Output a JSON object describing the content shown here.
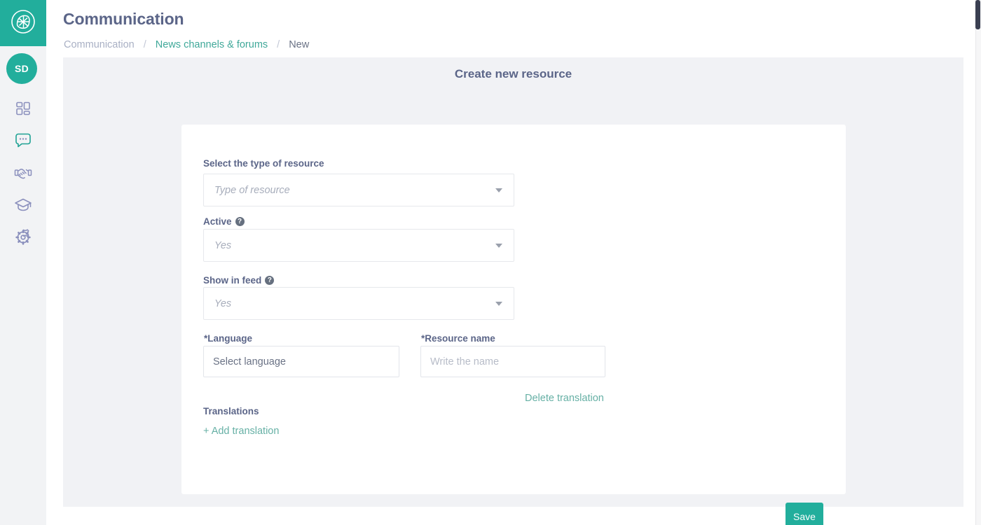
{
  "theme": {
    "accent": "#22ae9c",
    "link": "#66b0a5",
    "heading": "#5b6588",
    "muted": "#a9b0c4",
    "content_bg": "#f1f2f5",
    "sidebar_bg": "#f2f3f5"
  },
  "sidebar": {
    "logo": {
      "icon": "app-logo-icon"
    },
    "avatar": {
      "initials": "SD"
    },
    "items": [
      {
        "icon": "dashboard-grid-icon",
        "name": "sidebar-item-dashboard",
        "active": false
      },
      {
        "icon": "chat-bubble-icon",
        "name": "sidebar-item-communication",
        "active": true
      },
      {
        "icon": "handshake-icon",
        "name": "sidebar-item-collaboration",
        "active": false
      },
      {
        "icon": "graduation-cap-icon",
        "name": "sidebar-item-learning",
        "active": false
      },
      {
        "icon": "gear-icon",
        "name": "sidebar-item-settings",
        "active": false
      }
    ]
  },
  "header": {
    "title": "Communication",
    "breadcrumb": {
      "root": "Communication",
      "separator": "/",
      "section": "News channels & forums",
      "current": "New"
    }
  },
  "content": {
    "title": "Create new resource"
  },
  "form": {
    "type_of_resource": {
      "label": "Select the type of resource",
      "value": "Type of resource",
      "caret": "chevron-down-icon"
    },
    "active": {
      "label": "Active",
      "help": "?",
      "value": "Yes",
      "caret": "chevron-down-icon"
    },
    "show_in_feed": {
      "label": "Show in feed",
      "help": "?",
      "value": "Yes",
      "caret": "chevron-down-icon"
    },
    "language": {
      "label": "*Language",
      "value": "Select language"
    },
    "resource_name": {
      "label": "*Resource name",
      "placeholder": "Write the name",
      "value": "Write the name"
    },
    "delete_translation_label": "Delete translation",
    "translations_label": "Translations",
    "add_translation_label": "+ Add translation",
    "save_label": "Save"
  }
}
